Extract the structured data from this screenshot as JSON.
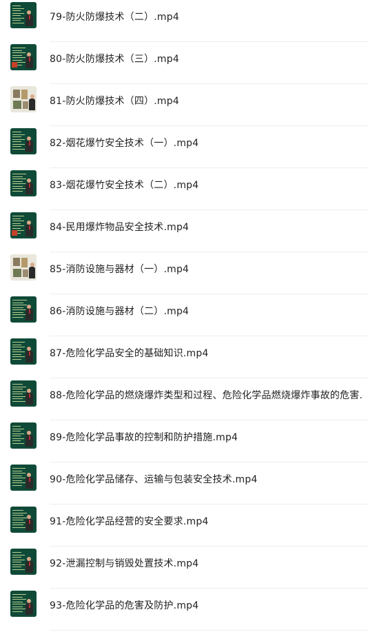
{
  "files": [
    {
      "name": "79-防火防爆技术（二）.mp4",
      "thumb": "lecture"
    },
    {
      "name": "80-防火防爆技术（三）.mp4",
      "thumb": "lecture-red"
    },
    {
      "name": "81-防火防爆技术（四）.mp4",
      "thumb": "photos"
    },
    {
      "name": "82-烟花爆竹安全技术（一）.mp4",
      "thumb": "lecture"
    },
    {
      "name": "83-烟花爆竹安全技术（二）.mp4",
      "thumb": "lecture"
    },
    {
      "name": "84-民用爆炸物品安全技术.mp4",
      "thumb": "lecture-red"
    },
    {
      "name": "85-消防设施与器材（一）.mp4",
      "thumb": "photos"
    },
    {
      "name": "86-消防设施与器材（二）.mp4",
      "thumb": "lecture"
    },
    {
      "name": "87-危险化学品安全的基础知识.mp4",
      "thumb": "lecture"
    },
    {
      "name": "88-危险化学品的燃烧爆炸类型和过程、危险化学品燃烧爆炸事故的危害.",
      "thumb": "lecture"
    },
    {
      "name": "89-危险化学品事故的控制和防护措施.mp4",
      "thumb": "lecture"
    },
    {
      "name": "90-危险化学品储存、运输与包装安全技术.mp4",
      "thumb": "lecture"
    },
    {
      "name": "91-危险化学品经营的安全要求.mp4",
      "thumb": "lecture"
    },
    {
      "name": "92-泄漏控制与销毁处置技术.mp4",
      "thumb": "lecture"
    },
    {
      "name": "93-危险化学品的危害及防护.mp4",
      "thumb": "lecture"
    }
  ]
}
